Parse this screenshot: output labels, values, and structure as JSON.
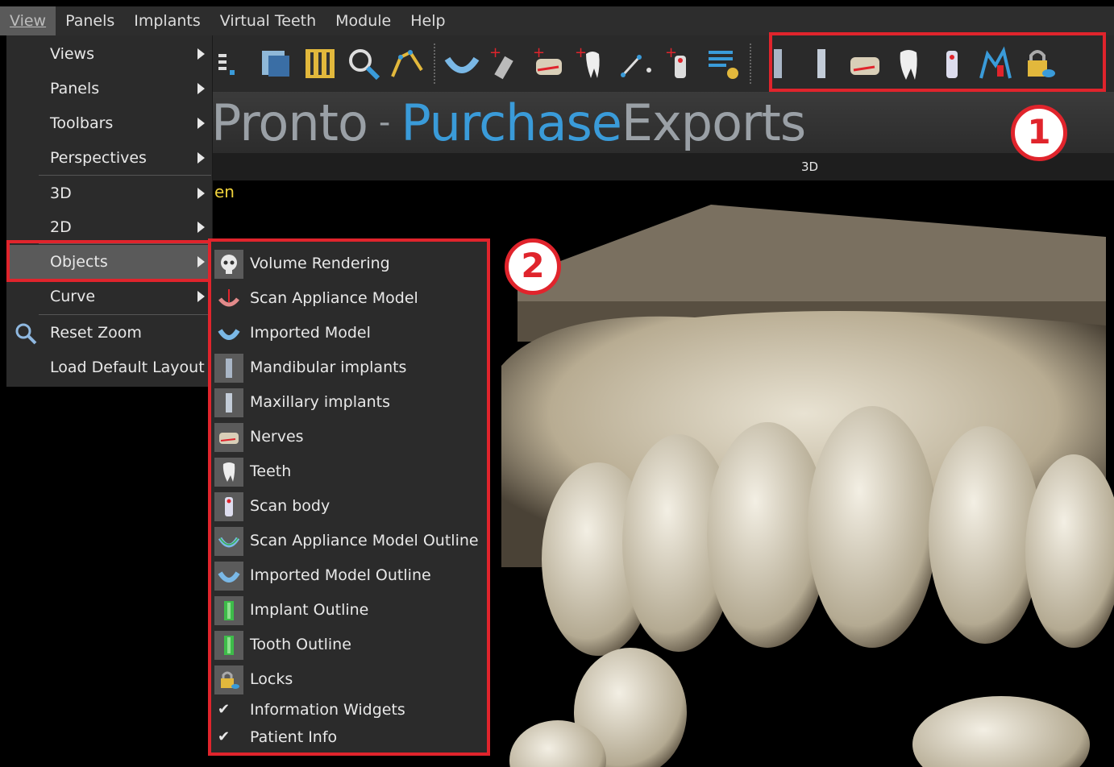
{
  "menubar": {
    "items": [
      "View",
      "Panels",
      "Implants",
      "Virtual Teeth",
      "Module",
      "Help"
    ]
  },
  "brand": {
    "part1": "Pronto",
    "dash": "-",
    "part2": "Purchase",
    "part3": "Exports"
  },
  "viewport": {
    "header": "3D",
    "fragment_label": "en"
  },
  "badges": [
    "1",
    "2"
  ],
  "view_menu": {
    "items": [
      {
        "label": "Views",
        "submenu": true
      },
      {
        "label": "Panels",
        "submenu": true
      },
      {
        "label": "Toolbars",
        "submenu": true
      },
      {
        "label": "Perspectives",
        "submenu": true
      },
      {
        "label": "3D",
        "submenu": true
      },
      {
        "label": "2D",
        "submenu": true
      },
      {
        "label": "Objects",
        "submenu": true
      },
      {
        "label": "Curve",
        "submenu": true
      },
      {
        "label": "Reset Zoom",
        "submenu": false
      },
      {
        "label": "Load Default Layout",
        "submenu": false
      }
    ]
  },
  "objects_menu": {
    "items": [
      {
        "label": "Volume Rendering",
        "icon": "skull-icon"
      },
      {
        "label": "Scan Appliance Model",
        "icon": "scan-appliance-icon"
      },
      {
        "label": "Imported Model",
        "icon": "imported-model-icon"
      },
      {
        "label": "Mandibular implants",
        "icon": "implant-icon"
      },
      {
        "label": "Maxillary implants",
        "icon": "implant-icon"
      },
      {
        "label": "Nerves",
        "icon": "nerve-icon"
      },
      {
        "label": "Teeth",
        "icon": "tooth-icon"
      },
      {
        "label": "Scan body",
        "icon": "scan-body-icon"
      },
      {
        "label": "Scan Appliance Model Outline",
        "icon": "scan-appliance-outline-icon"
      },
      {
        "label": "Imported Model Outline",
        "icon": "imported-model-outline-icon"
      },
      {
        "label": "Implant Outline",
        "icon": "implant-outline-icon"
      },
      {
        "label": "Tooth Outline",
        "icon": "tooth-outline-icon"
      },
      {
        "label": "Locks",
        "icon": "lock-icon"
      },
      {
        "label": "Information Widgets",
        "checked": true
      },
      {
        "label": "Patient Info",
        "checked": true
      }
    ]
  },
  "colors": {
    "highlight": "#e0242c",
    "brand_blue": "#3a9bd9",
    "menu_bg": "#2b2b2b"
  }
}
